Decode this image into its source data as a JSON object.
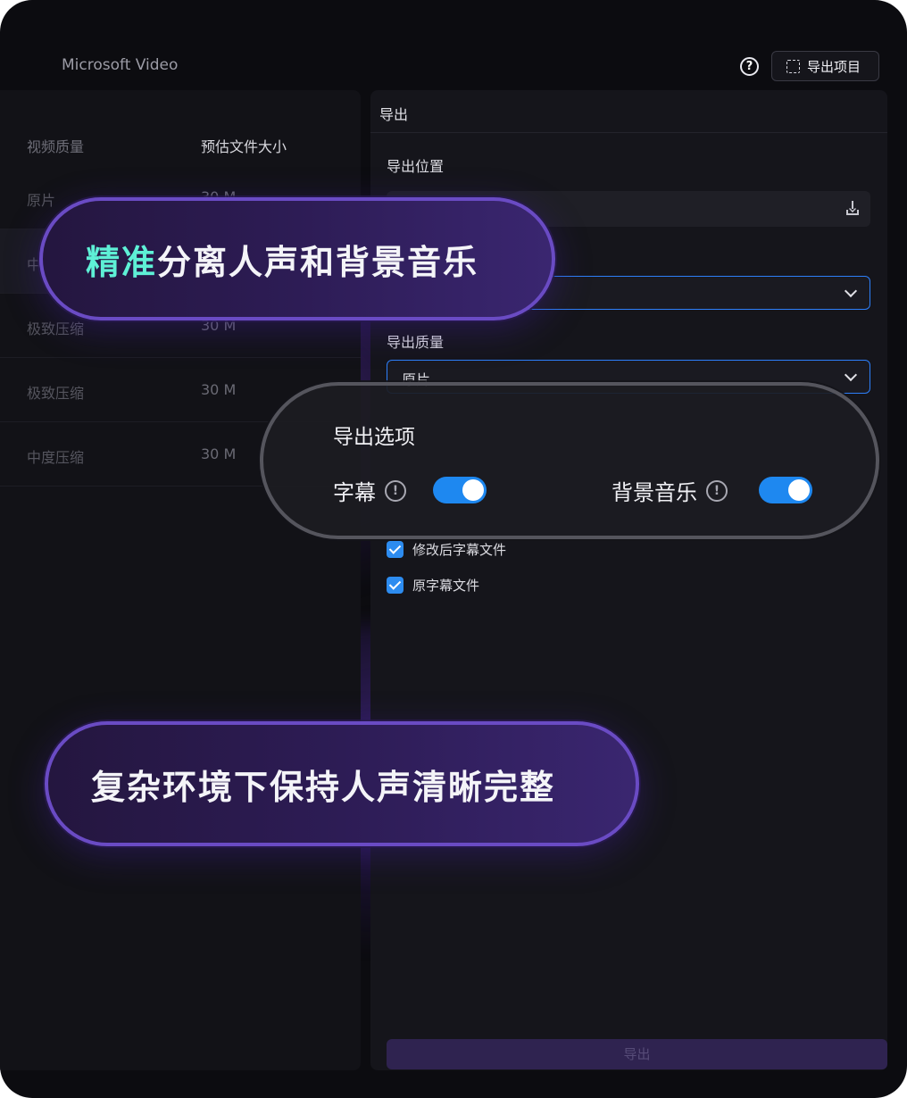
{
  "app": {
    "title": "Microsoft Video"
  },
  "header": {
    "help_icon": "question-circle-icon",
    "export_project_label": "导出项目",
    "export_project_icon": "dashed-square-icon"
  },
  "left_panel": {
    "headers": {
      "quality": "视频质量",
      "size": "预估文件大小"
    },
    "rows": [
      {
        "quality": "原片",
        "size": "30 M"
      },
      {
        "quality": "中",
        "size": ""
      },
      {
        "quality": "极致压缩",
        "size": "30 M"
      },
      {
        "quality": "极致压缩",
        "size": "30 M"
      },
      {
        "quality": "中度压缩",
        "size": "30 M"
      }
    ]
  },
  "right_panel": {
    "title": "导出",
    "location_label": "导出位置",
    "location_value": "",
    "download_icon": "download-icon",
    "format_value": "",
    "quality_label": "导出质量",
    "quality_value": "原片",
    "checkbox_modified": "修改后字幕文件",
    "checkbox_original": "原字幕文件",
    "export_button": "导出"
  },
  "promo": {
    "top_accent": "精准",
    "top_rest": "分离人声和背景音乐",
    "bottom": "复杂环境下保持人声清晰完整"
  },
  "options_card": {
    "title": "导出选项",
    "subtitle_label": "字幕",
    "bgm_label": "背景音乐",
    "info_glyph": "!",
    "subtitle_on": true,
    "bgm_on": true
  },
  "colors": {
    "accent": "#5ef0d6",
    "toggle": "#1e88f0",
    "pill_border": "#6a4bc4"
  }
}
